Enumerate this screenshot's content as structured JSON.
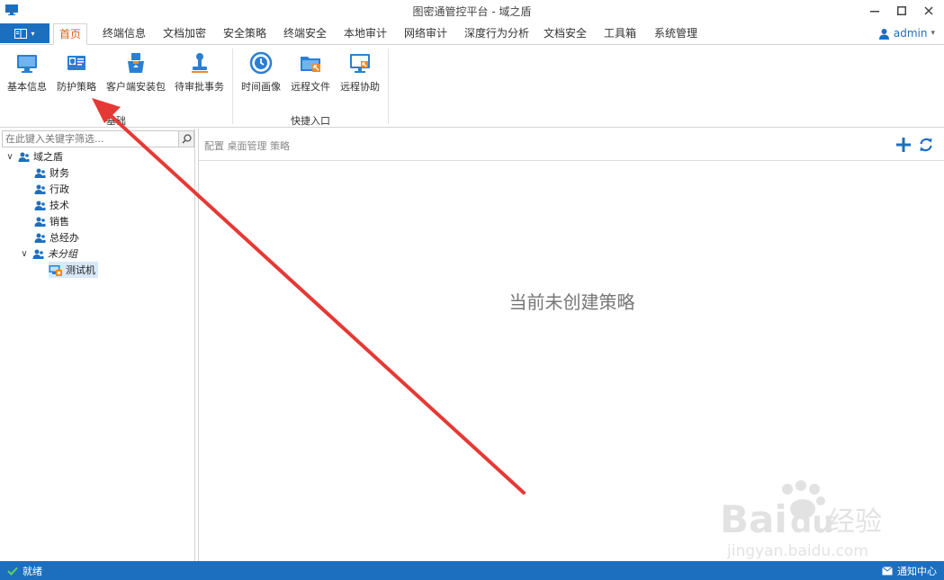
{
  "window": {
    "title": "图密通管控平台 - 域之盾"
  },
  "tabs": [
    {
      "label": "首页",
      "active": true
    },
    {
      "label": "终端信息"
    },
    {
      "label": "文档加密"
    },
    {
      "label": "安全策略"
    },
    {
      "label": "终端安全"
    },
    {
      "label": "本地审计"
    },
    {
      "label": "网络审计"
    },
    {
      "label": "深度行为分析"
    },
    {
      "label": "文档安全"
    },
    {
      "label": "工具箱"
    },
    {
      "label": "系统管理"
    }
  ],
  "user": {
    "name": "admin",
    "caret": "▾"
  },
  "ribbon": {
    "groups": [
      {
        "label": "基础"
      },
      {
        "label": "快捷入口"
      }
    ],
    "buttons": [
      {
        "label": "基本信息",
        "icon": "monitor-icon"
      },
      {
        "label": "防护策略",
        "icon": "policy-card-icon"
      },
      {
        "label": "客户端安装包",
        "icon": "install-package-icon"
      },
      {
        "label": "待审批事务",
        "icon": "approval-stamp-icon"
      },
      {
        "label": "时间画像",
        "icon": "clock-icon"
      },
      {
        "label": "远程文件",
        "icon": "remote-folder-icon"
      },
      {
        "label": "远程协助",
        "icon": "remote-assist-icon"
      }
    ]
  },
  "left": {
    "search_placeholder": "在此键入关键字筛选...",
    "tree": {
      "root": "域之盾",
      "children": [
        "财务",
        "行政",
        "技术",
        "销售",
        "总经办"
      ],
      "ungrouped": "未分组",
      "ungrouped_children": [
        "测试机"
      ]
    }
  },
  "main": {
    "breadcrumb": "配置 桌面管理 策略",
    "empty_text": "当前未创建策略"
  },
  "status": {
    "left_text": "就绪",
    "right_text": "通知中心"
  },
  "watermark": {
    "logo_text": "Bai",
    "logo_text2": "du",
    "brand": "经验",
    "url": "jingyan.baidu.com"
  },
  "colors": {
    "accent": "#1c6fbf",
    "active_tab": "#e0601a",
    "arrow": "#e53935"
  }
}
